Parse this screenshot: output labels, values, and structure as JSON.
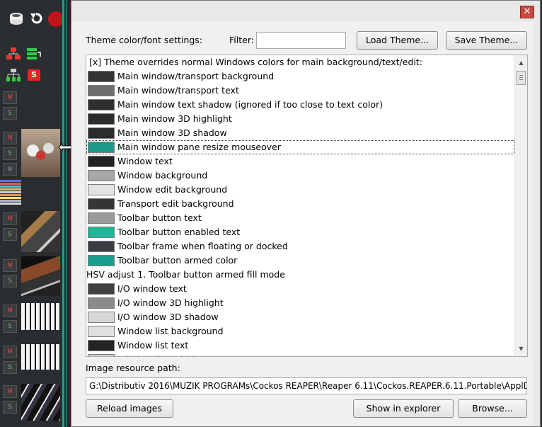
{
  "dialog": {
    "close_glyph": "✕",
    "theme_settings_label": "Theme color/font settings:",
    "filter_label": "Filter:",
    "filter_value": "",
    "load_theme_label": "Load Theme...",
    "save_theme_label": "Save Theme...",
    "image_path_label": "Image resource path:",
    "image_path_value": "G:\\Distributiv 2016\\MUZIK PROGRAMs\\Cockos REAPER\\Reaper 6.11\\Cockos.REAPER.6.11.Portable\\ApplData\\ColorThemes",
    "reload_images_label": "Reload images",
    "show_in_explorer_label": "Show in explorer",
    "browse_label": "Browse..."
  },
  "list": {
    "rows": [
      {
        "type": "header",
        "text": "[x] Theme overrides normal Windows colors for main background/text/edit:"
      },
      {
        "type": "color",
        "text": "Main window/transport background",
        "color": "#333333"
      },
      {
        "type": "color",
        "text": "Main window/transport text",
        "color": "#6e6e6e"
      },
      {
        "type": "color",
        "text": "Main window text shadow (ignored if too close to text color)",
        "color": "#2f2f2f"
      },
      {
        "type": "color",
        "text": "Main window 3D highlight",
        "color": "#2c2c2c"
      },
      {
        "type": "color",
        "text": "Main window 3D shadow",
        "color": "#2c2c2c"
      },
      {
        "type": "color",
        "text": "Main window pane resize mouseover",
        "color": "#1a9a88",
        "selected": true
      },
      {
        "type": "color",
        "text": "Window text",
        "color": "#222222"
      },
      {
        "type": "color",
        "text": "Window background",
        "color": "#a7a7a7"
      },
      {
        "type": "color",
        "text": "Window edit background",
        "color": "#e3e3e3"
      },
      {
        "type": "color",
        "text": "Transport edit background",
        "color": "#353535"
      },
      {
        "type": "color",
        "text": "Toolbar button text",
        "color": "#9a9a9a"
      },
      {
        "type": "color",
        "text": "Toolbar button enabled text",
        "color": "#22b597"
      },
      {
        "type": "color",
        "text": "Toolbar frame when floating or docked",
        "color": "#3a3d3f"
      },
      {
        "type": "color",
        "text": "Toolbar button armed color",
        "color": "#1a9e8d"
      },
      {
        "type": "plain",
        "text": "HSV adjust 1. Toolbar button armed fill mode"
      },
      {
        "type": "color",
        "text": "I/O window text",
        "color": "#404040"
      },
      {
        "type": "color",
        "text": "I/O window 3D highlight",
        "color": "#8a8a8a"
      },
      {
        "type": "color",
        "text": "I/O window 3D shadow",
        "color": "#d7d7d7"
      },
      {
        "type": "color",
        "text": "Window list background",
        "color": "#e0e0e0"
      },
      {
        "type": "color",
        "text": "Window list text",
        "color": "#242424"
      },
      {
        "type": "color",
        "text": "Window list grid lines",
        "color": "#d0d0d0"
      }
    ]
  },
  "reaper": {
    "mute_label": "M",
    "solo_label": "S",
    "phase_label": "⊘"
  }
}
